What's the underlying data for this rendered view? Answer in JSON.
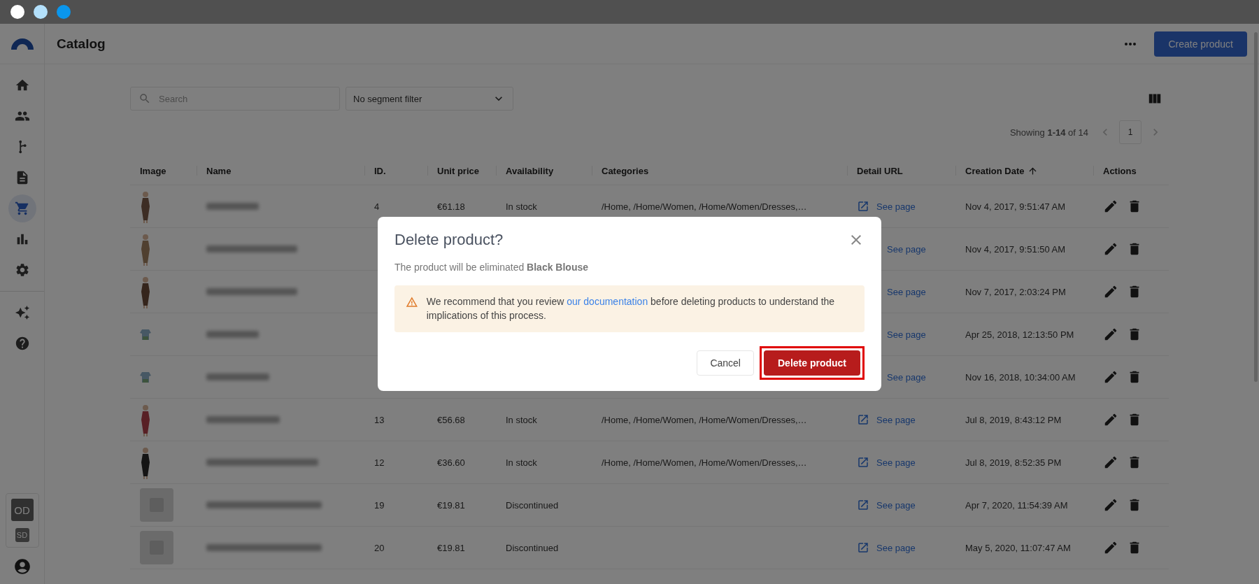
{
  "window_controls": [
    {
      "color": "#ffffff"
    },
    {
      "color": "#b3e0fb"
    },
    {
      "color": "#0a96ec"
    }
  ],
  "sidebar": {
    "items": [
      {
        "selected": false
      },
      {
        "selected": false
      },
      {
        "selected": false
      },
      {
        "selected": false
      },
      {
        "selected": true
      },
      {
        "selected": false
      },
      {
        "selected": false
      }
    ],
    "extra_items": [
      {
        "selected": false
      },
      {
        "selected": false
      }
    ],
    "workspaces": [
      {
        "label": "OD",
        "selected": true
      },
      {
        "label": "SD",
        "selected": false
      }
    ]
  },
  "header": {
    "title": "Catalog",
    "primary_button": "Create product"
  },
  "toolbar": {
    "search": {
      "placeholder": "Search"
    },
    "segment_filter": {
      "value": "No segment filter"
    }
  },
  "pagination": {
    "summary": "Showing **1-14** of 14",
    "page": "1"
  },
  "table": {
    "columns": [
      {
        "label": "Image",
        "sorted": false
      },
      {
        "label": "Name",
        "sorted": false
      },
      {
        "label": "ID.",
        "sorted": false
      },
      {
        "label": "Unit price",
        "sorted": false
      },
      {
        "label": "Availability",
        "sorted": false
      },
      {
        "label": "Categories",
        "sorted": false
      },
      {
        "label": "Detail URL",
        "sorted": false
      },
      {
        "label": "Creation Date",
        "sorted": true
      },
      {
        "label": "Actions",
        "sorted": false
      }
    ],
    "rows": [
      {
        "id": "4",
        "price": "€61.18",
        "availability": "In stock",
        "categories": "/Home, /Home/Women, /Home/Women/Dresses,…",
        "url": {
          "label": "See page",
          "icon": true
        },
        "created": "Nov 4, 2017, 9:51:47 AM"
      },
      {
        "url": {
          "label": "See page",
          "icon": false
        },
        "created": "Nov 4, 2017, 9:51:50 AM"
      },
      {
        "url": {
          "label": "See page",
          "icon": false
        },
        "created": "Nov 7, 2017, 2:03:24 PM"
      },
      {
        "url": {
          "label": "See page",
          "icon": false
        },
        "created": "Apr 25, 2018, 12:13:50 PM"
      },
      {
        "url": {
          "label": "See page",
          "icon": false
        },
        "created": "Nov 16, 2018, 10:34:00 AM"
      },
      {
        "id": "13",
        "price": "€56.68",
        "availability": "In stock",
        "categories": "/Home, /Home/Women, /Home/Women/Dresses,…",
        "url": {
          "label": "See page",
          "icon": true
        },
        "created": "Jul 8, 2019, 8:43:12 PM"
      },
      {
        "id": "12",
        "price": "€36.60",
        "availability": "In stock",
        "categories": "/Home, /Home/Women, /Home/Women/Dresses,…",
        "url": {
          "label": "See page",
          "icon": true
        },
        "created": "Jul 8, 2019, 8:52:35 PM"
      },
      {
        "id": "19",
        "price": "€19.81",
        "availability": "Discontinued",
        "url": {
          "label": "See page",
          "icon": true
        },
        "created": "Apr 7, 2020, 11:54:39 AM"
      },
      {
        "id": "20",
        "price": "€19.81",
        "availability": "Discontinued",
        "url": {
          "label": "See page",
          "icon": true
        },
        "created": "May 5, 2020, 11:07:47 AM"
      }
    ]
  },
  "dialog": {
    "title": "Delete product?",
    "message": "The product will be eliminated **Black Blouse**",
    "warning": {
      "before": "We recommend that you review",
      "link": "our documentation",
      "after": "before deleting products to understand the implications of this process."
    },
    "cancel": "Cancel",
    "confirm": {
      "label": "Delete product",
      "highlighted": true
    }
  }
}
